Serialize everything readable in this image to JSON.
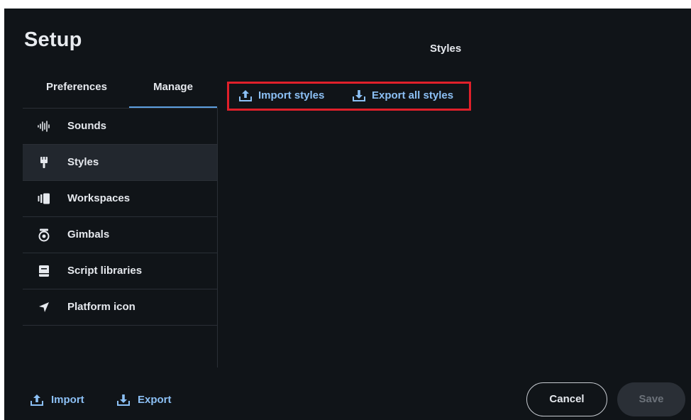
{
  "dialog": {
    "title": "Setup",
    "section_title": "Styles"
  },
  "tabs": [
    {
      "label": "Preferences",
      "selected": false
    },
    {
      "label": "Manage",
      "selected": true
    }
  ],
  "sidebar": {
    "items": [
      {
        "label": "Sounds",
        "icon": "waveform-icon",
        "selected": false
      },
      {
        "label": "Styles",
        "icon": "brush-icon",
        "selected": true
      },
      {
        "label": "Workspaces",
        "icon": "workspaces-icon",
        "selected": false
      },
      {
        "label": "Gimbals",
        "icon": "gimbal-icon",
        "selected": false
      },
      {
        "label": "Script libraries",
        "icon": "book-icon",
        "selected": false
      },
      {
        "label": "Platform icon",
        "icon": "navigation-arrow-icon",
        "selected": false
      }
    ]
  },
  "actions": {
    "import_styles": "Import styles",
    "export_all_styles": "Export all styles"
  },
  "footer": {
    "import": "Import",
    "export": "Export",
    "cancel": "Cancel",
    "save": "Save"
  },
  "colors": {
    "background": "#101418",
    "accent": "#8cc0f5",
    "tab_underline": "#5d9fe0",
    "selected_item": "#22272e",
    "highlight_box": "#e0202a"
  }
}
